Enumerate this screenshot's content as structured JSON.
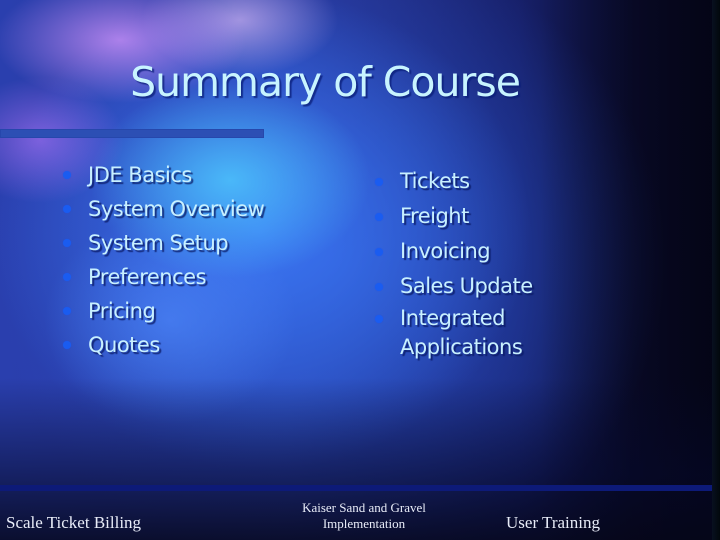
{
  "slide": {
    "title": "Summary of Course",
    "left_column": {
      "items": [
        {
          "label": "JDE Basics",
          "icon": "bullet-dot-icon"
        },
        {
          "label": "System Overview",
          "icon": "bullet-dot-icon"
        },
        {
          "label": "System Setup",
          "icon": "bullet-dot-icon"
        },
        {
          "label": "Preferences",
          "icon": "bullet-dot-icon"
        },
        {
          "label": "Pricing",
          "icon": "bullet-dot-icon"
        },
        {
          "label": "Quotes",
          "icon": "bullet-dot-icon"
        }
      ]
    },
    "right_column": {
      "items": [
        {
          "label": "Tickets",
          "icon": "bullet-dot-icon"
        },
        {
          "label": "Freight",
          "icon": "bullet-dot-icon"
        },
        {
          "label": "Invoicing",
          "icon": "bullet-dot-icon"
        },
        {
          "label": "Sales Update",
          "icon": "bullet-dot-icon"
        },
        {
          "label": "Integrated",
          "label_line2": "Applications",
          "icon": "bullet-dot-icon"
        }
      ]
    },
    "footer": {
      "left": "Scale Ticket Billing",
      "center_line1": "Kaiser Sand and Gravel",
      "center_line2": "Implementation",
      "right": "User Training"
    },
    "colors": {
      "title_text": "#c8f4ff",
      "body_text": "#c8f0ff",
      "bullet": "#1a5cf0",
      "title_rule": "#2c4fb4",
      "footer_rule": "#0d1a78",
      "footer_text": "#e8ecf8"
    }
  }
}
